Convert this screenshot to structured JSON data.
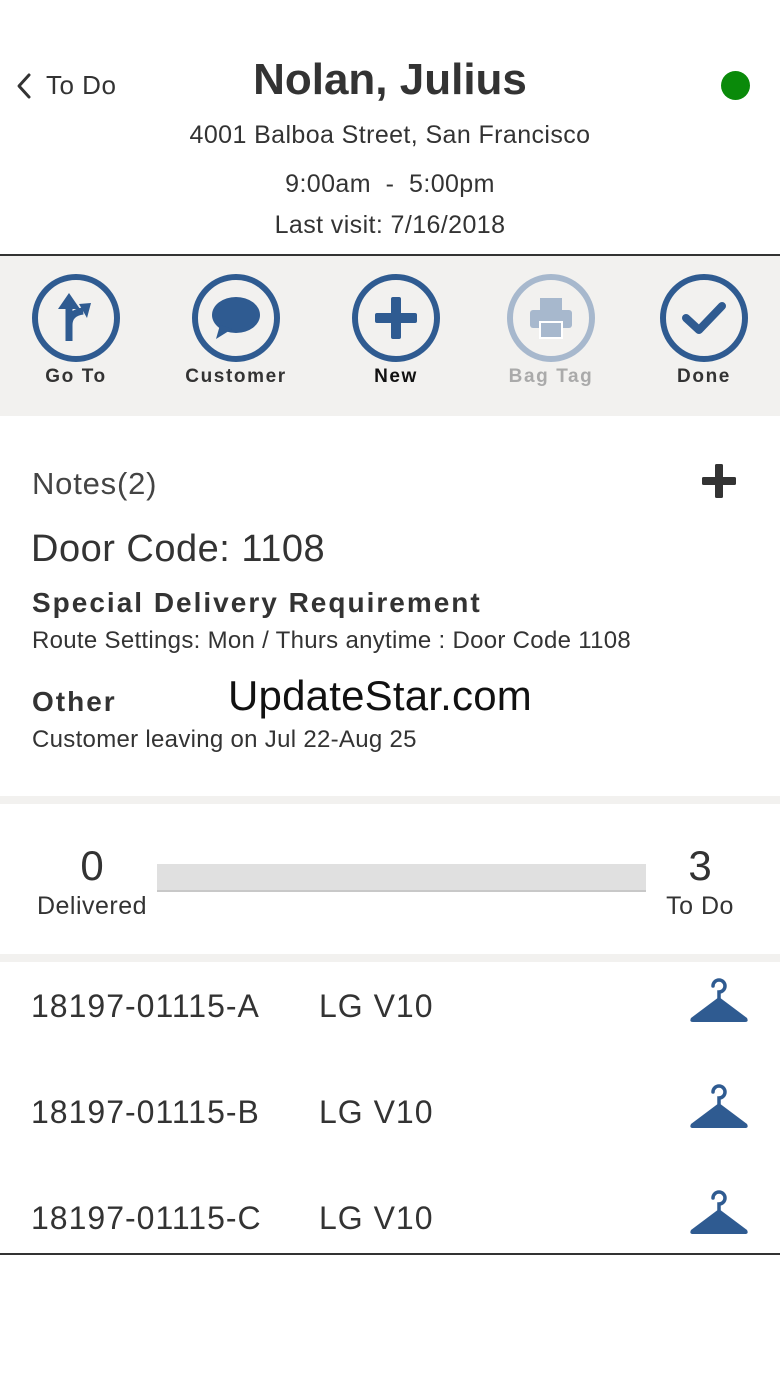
{
  "header": {
    "back_label": "To Do",
    "customer_name": "Nolan, Julius",
    "address": "4001 Balboa Street, San Francisco",
    "hours": "9:00am  -  5:00pm",
    "last_visit": "Last visit: 7/16/2018",
    "status_color": "#0a8a0a"
  },
  "toolbar": {
    "items": [
      {
        "label": "Go To",
        "icon": "directions-icon",
        "enabled": true
      },
      {
        "label": "Customer",
        "icon": "chat-bubble-icon",
        "enabled": true
      },
      {
        "label": "New",
        "icon": "plus-icon",
        "enabled": true
      },
      {
        "label": "Bag Tag",
        "icon": "printer-icon",
        "enabled": false
      },
      {
        "label": "Done",
        "icon": "checkmark-icon",
        "enabled": true
      }
    ],
    "accent_color": "#2f5b91"
  },
  "notes": {
    "title": "Notes(2)",
    "door_code": "Door Code: 1108",
    "sections": [
      {
        "heading": "Special Delivery Requirement",
        "text": "Route Settings: Mon / Thurs anytime : Door Code 1108"
      },
      {
        "heading": "Other",
        "text": "Customer leaving on Jul 22-Aug 25"
      }
    ],
    "watermark": "UpdateStar.com"
  },
  "progress": {
    "delivered_count": "0",
    "delivered_label": "Delivered",
    "todo_count": "3",
    "todo_label": "To Do",
    "fraction_delivered": 0
  },
  "items": [
    {
      "id": "18197-01115-A",
      "model": "LG V10",
      "icon": "hanger-icon"
    },
    {
      "id": "18197-01115-B",
      "model": "LG V10",
      "icon": "hanger-icon"
    },
    {
      "id": "18197-01115-C",
      "model": "LG V10",
      "icon": "hanger-icon"
    }
  ]
}
